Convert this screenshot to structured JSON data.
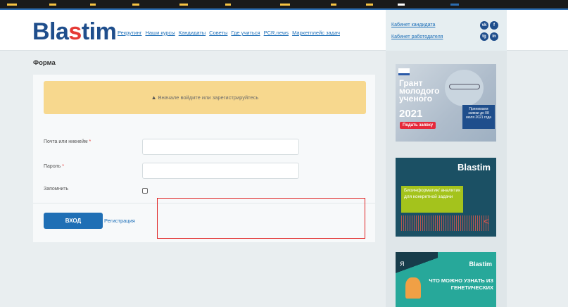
{
  "header": {
    "logo_main": "Blastim",
    "nav": [
      "Рекрутинг",
      "Наши курсы",
      "Кандидаты",
      "Советы",
      "Где учиться",
      "PCR.news",
      "Маркетплейс задач"
    ]
  },
  "account": {
    "candidate_link": "Кабинет кандидата",
    "employer_link": "Кабинет работодателя",
    "social": [
      "vk",
      "f",
      "tg",
      "in"
    ]
  },
  "page": {
    "title": "Форма"
  },
  "form": {
    "alert_text": "Вначале войдите или зарегистрируйтесь",
    "email_label": "Почта или никнейм",
    "password_label": "Пароль",
    "required_mark": "*",
    "remember_label": "Запомнить",
    "login_button": "ВХОД",
    "register_link": "Регистрация"
  },
  "banners": {
    "grant": {
      "title": "Грант молодого ученого",
      "year": "2021",
      "button": "Подать заявку",
      "info": "Принимаем заявки до 08 июля 2021 года"
    },
    "bioinf": {
      "brand": "Blastim",
      "text": "Биоинформатик/ аналитик для конкретной задачи",
      "arrow": "<"
    },
    "genetics": {
      "partner": "Я",
      "brand": "Blastim",
      "text": "ЧТО МОЖНО УЗНАТЬ ИЗ ГЕНЕТИЧЕСКИХ"
    }
  },
  "colors": {
    "brand_blue": "#1f4e8c",
    "link_blue": "#1d6fb8",
    "alert_yellow": "#f7d88e",
    "button_blue": "#1f6fb5",
    "required_red": "#e53935",
    "highlight_red": "#e02020"
  }
}
